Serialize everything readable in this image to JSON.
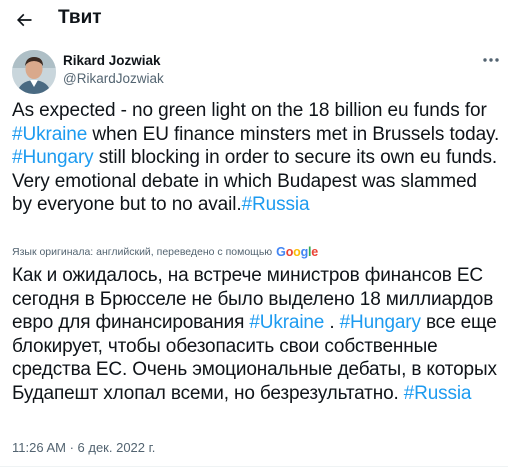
{
  "header": {
    "title": "Твит",
    "back_icon": "arrow-left-icon"
  },
  "author": {
    "display_name": "Rikard Jozwiak",
    "handle": "@RikardJozwiak",
    "more_icon": "more-horizontal-icon"
  },
  "tweet": {
    "segments": [
      {
        "text": "As expected - no green light on the 18 billion eu funds for ",
        "hashtag": false
      },
      {
        "text": "#Ukraine",
        "hashtag": true
      },
      {
        "text": " when EU finance minsters met in Brussels today. ",
        "hashtag": false
      },
      {
        "text": "#Hungary",
        "hashtag": true
      },
      {
        "text": " still blocking in order to secure its own eu funds. Very emotional debate in which Budapest was slammed by everyone but to no avail.",
        "hashtag": false
      },
      {
        "text": "#Russia",
        "hashtag": true
      }
    ]
  },
  "translation": {
    "note": "Язык оригинала: английский, переведено с помощью",
    "provider": "Google",
    "segments": [
      {
        "text": "Как и ожидалось, на встрече министров финансов ЕС сегодня в Брюсселе не было выделено 18 миллиардов евро для финансирования ",
        "hashtag": false
      },
      {
        "text": "#Ukraine",
        "hashtag": true
      },
      {
        "text": " . ",
        "hashtag": false
      },
      {
        "text": "#Hungary",
        "hashtag": true
      },
      {
        "text": " все еще блокирует, чтобы обезопасить свои собственные средства ЕС. Очень эмоциональные дебаты, в которых Будапешт хлопал всеми, но безрезультатно. ",
        "hashtag": false
      },
      {
        "text": "#Russia",
        "hashtag": true
      }
    ]
  },
  "meta": {
    "timestamp": "11:26 AM · 6 дек. 2022 г."
  },
  "colors": {
    "accent": "#1d9bf0",
    "text": "#0f1419",
    "secondary": "#536471"
  }
}
